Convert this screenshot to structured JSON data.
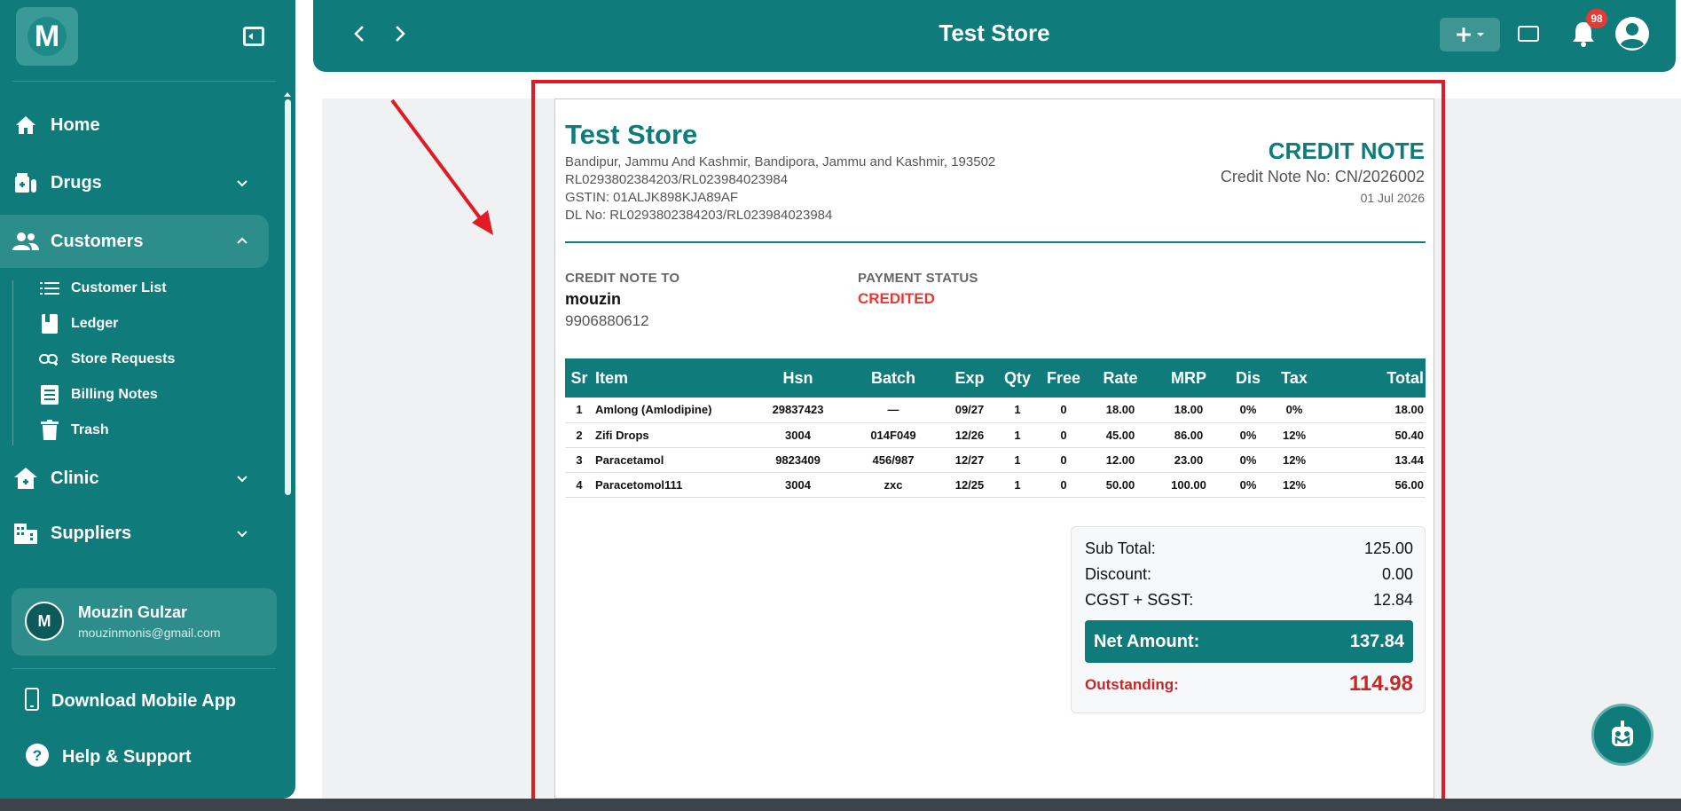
{
  "sidebar": {
    "logo_letter": "M",
    "items": [
      {
        "label": "Home"
      },
      {
        "label": "Drugs"
      },
      {
        "label": "Customers"
      },
      {
        "label": "Clinic"
      },
      {
        "label": "Suppliers"
      }
    ],
    "customer_subitems": [
      {
        "label": "Customer List"
      },
      {
        "label": "Ledger"
      },
      {
        "label": "Store Requests"
      },
      {
        "label": "Billing Notes"
      },
      {
        "label": "Trash"
      }
    ],
    "user": {
      "initial": "M",
      "name": "Mouzin Gulzar",
      "email": "mouzinmonis@gmail.com"
    },
    "download_app": "Download Mobile App",
    "help": "Help & Support"
  },
  "topbar": {
    "title": "Test Store",
    "notification_count": "98"
  },
  "document": {
    "store_name": "Test Store",
    "address_line": "Bandipur, Jammu And Kashmir, Bandipora, Jammu and Kashmir, 193502",
    "reg_line": "RL0293802384203/RL023984023984",
    "gstin": "GSTIN: 01ALJK898KJA89AF",
    "dl_no": "DL No: RL0293802384203/RL023984023984",
    "doc_title": "CREDIT NOTE",
    "doc_no": "Credit Note No: CN/2026002",
    "doc_date": "01 Jul 2026",
    "credit_to_label": "CREDIT NOTE TO",
    "customer_name": "mouzin",
    "customer_phone": "9906880612",
    "payment_status_label": "PAYMENT STATUS",
    "payment_status": "CREDITED",
    "table": {
      "headers": [
        "Sr",
        "Item",
        "Hsn",
        "Batch",
        "Exp",
        "Qty",
        "Free",
        "Rate",
        "MRP",
        "Dis",
        "Tax",
        "Total"
      ],
      "rows": [
        [
          "1",
          "Amlong (Amlodipine)",
          "29837423",
          "—",
          "09/27",
          "1",
          "0",
          "18.00",
          "18.00",
          "0%",
          "0%",
          "18.00"
        ],
        [
          "2",
          "Zifi Drops",
          "3004",
          "014F049",
          "12/26",
          "1",
          "0",
          "45.00",
          "86.00",
          "0%",
          "12%",
          "50.40"
        ],
        [
          "3",
          "Paracetamol",
          "9823409",
          "456/987",
          "12/27",
          "1",
          "0",
          "12.00",
          "23.00",
          "0%",
          "12%",
          "13.44"
        ],
        [
          "4",
          "Paracetomol111",
          "3004",
          "zxc",
          "12/25",
          "1",
          "0",
          "50.00",
          "100.00",
          "0%",
          "12%",
          "56.00"
        ]
      ]
    },
    "totals": {
      "sub_total_label": "Sub Total:",
      "sub_total": "125.00",
      "discount_label": "Discount:",
      "discount": "0.00",
      "tax_label": "CGST + SGST:",
      "tax": "12.84",
      "net_label": "Net Amount:",
      "net": "137.84",
      "outstanding_label": "Outstanding:",
      "outstanding": "114.98"
    }
  },
  "colors": {
    "primary": "#0f7b7b",
    "highlight": "#e01b24",
    "status": "#e53935"
  }
}
